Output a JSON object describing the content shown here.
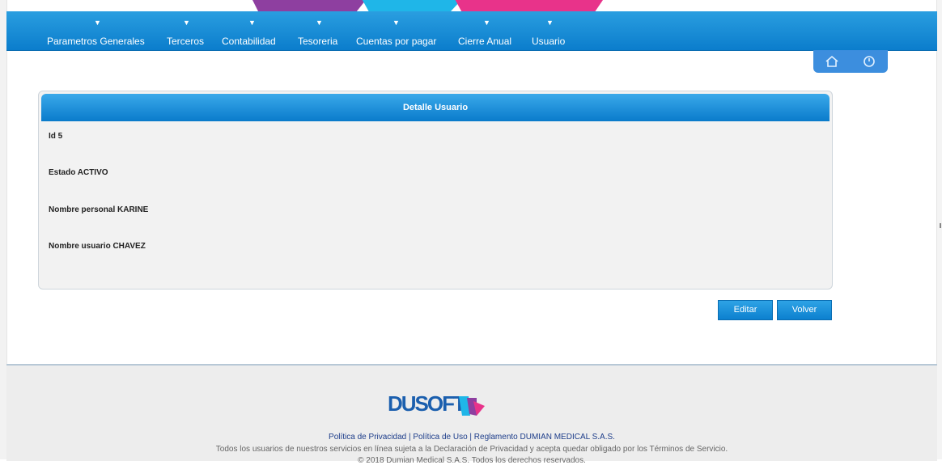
{
  "nav": {
    "items": [
      {
        "label": "Parametros Generales"
      },
      {
        "label": "Terceros"
      },
      {
        "label": "Contabilidad"
      },
      {
        "label": "Tesoreria"
      },
      {
        "label": "Cuentas por pagar"
      },
      {
        "label": "Cierre Anual"
      },
      {
        "label": "Usuario"
      }
    ],
    "arrow": "▼",
    "color": "#0b7dcc"
  },
  "quick": {
    "home_icon": "home-icon",
    "power_icon": "power-icon"
  },
  "panel": {
    "title": "Detalle Usuario",
    "fields": [
      {
        "text": "Id 5"
      },
      {
        "text": "Estado ACTIVO"
      },
      {
        "text": "Nombre personal KARINE"
      },
      {
        "text": "Nombre usuario CHAVEZ"
      }
    ]
  },
  "actions": {
    "edit": "Editar",
    "back": "Volver"
  },
  "footer": {
    "logo": "DUSOFT",
    "link_privacy": "Política de Privacidad",
    "sep1": " | ",
    "link_use": "Política de Uso",
    "sep2": " | ",
    "link_rules": "Reglamento DUMIAN MEDICAL S.A.S.",
    "disclaimer": "Todos los usuarios de nuestros servicios en línea sujeta a la Declaración de Privacidad y acepta quedar obligado por los Términos de Servicio.",
    "copyright": "© 2018 Dumian Medical S.A.S. Todos los derechos reservados."
  }
}
